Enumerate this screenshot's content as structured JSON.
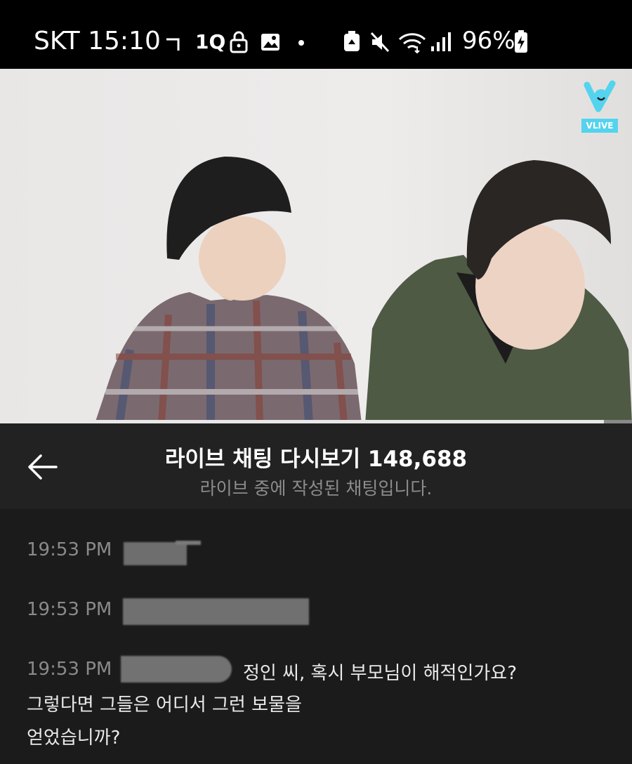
{
  "status_bar": {
    "carrier_time": "SKT 15:10",
    "battery": "96%",
    "icons": [
      "nfc-icon",
      "lock-icon",
      "image-icon",
      "dot-icon",
      "recycle-icon",
      "mute-icon",
      "wifi-icon",
      "signal-icon",
      "battery-icon"
    ]
  },
  "video": {
    "logo_text": "VLIVE",
    "progress_fraction": 0.955
  },
  "header": {
    "title": "라이브 채팅 다시보기 148,688",
    "subtitle": "라이브 중에 작성된 채팅입니다."
  },
  "chat": {
    "messages": [
      {
        "time": "19:53 PM",
        "text": ""
      },
      {
        "time": "19:53 PM",
        "text": ""
      },
      {
        "time": "19:53 PM",
        "text": "정인 씨, 혹시 부모님이 해적인가요?",
        "line2": "그렇다면 그들은 어디서 그런 보물을",
        "line3": "얻었습니까?"
      }
    ]
  },
  "colors": {
    "accent_vlive": "#54d3ee",
    "background": "#1b1b1b"
  }
}
